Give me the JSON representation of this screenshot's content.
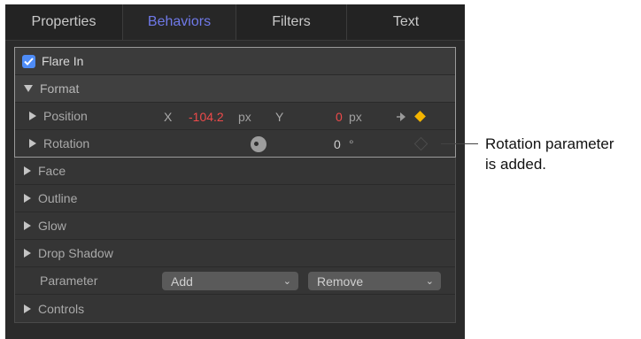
{
  "tabs": [
    {
      "label": "Properties",
      "active": false
    },
    {
      "label": "Behaviors",
      "active": true
    },
    {
      "label": "Filters",
      "active": false
    },
    {
      "label": "Text",
      "active": false
    }
  ],
  "behavior": {
    "name": "Flare In",
    "enabled": true
  },
  "rows": {
    "format": "Format",
    "position": {
      "label": "Position",
      "x_label": "X",
      "x_value": "-104.2",
      "x_unit": "px",
      "y_label": "Y",
      "y_value": "0",
      "y_unit": "px"
    },
    "rotation": {
      "label": "Rotation",
      "value": "0",
      "unit": "°"
    },
    "face": "Face",
    "outline": "Outline",
    "glow": "Glow",
    "drop_shadow": "Drop Shadow",
    "parameter": {
      "label": "Parameter",
      "add": "Add",
      "remove": "Remove"
    },
    "controls": "Controls"
  },
  "annotation": {
    "line1": "Rotation parameter",
    "line2": "is added."
  },
  "colors": {
    "accent": "#6f79e8",
    "checkbox": "#4e8cf7",
    "keyframe": "#f4b400",
    "negative_value": "#ee4a4a"
  },
  "icons": [
    "checkmark-icon",
    "triangle-right-icon",
    "triangle-down-icon",
    "rotation-dial-icon",
    "keyframe-navigate-icon",
    "keyframe-diamond-icon",
    "chevron-down-icon"
  ]
}
